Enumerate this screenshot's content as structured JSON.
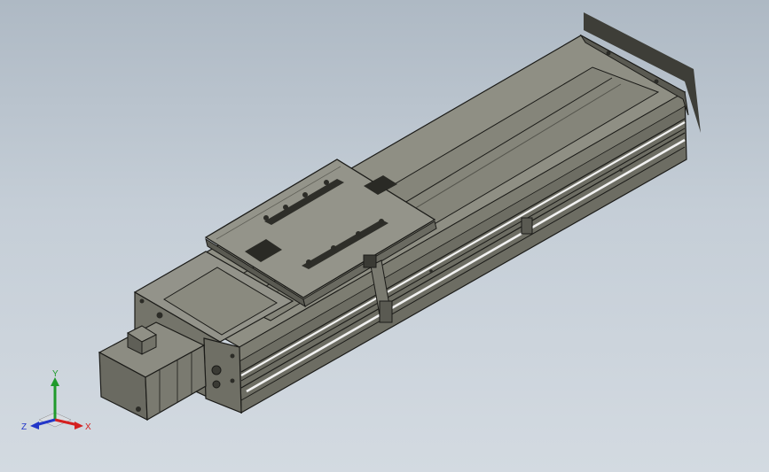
{
  "model": {
    "name": "linear-actuator-module",
    "colors": {
      "body_top": "#8e8e82",
      "body_side": "#6c6c62",
      "body_dark": "#4d4d45",
      "edge": "#1b1b18",
      "highlight": "#f2f2f2",
      "background_top": "#aeb9c4",
      "background_bottom": "#d3dae1"
    }
  },
  "triad": {
    "x_label": "X",
    "y_label": "Y",
    "z_label": "Z",
    "colors": {
      "x": "#d42020",
      "y": "#1f9a2b",
      "z": "#2236c8"
    }
  }
}
